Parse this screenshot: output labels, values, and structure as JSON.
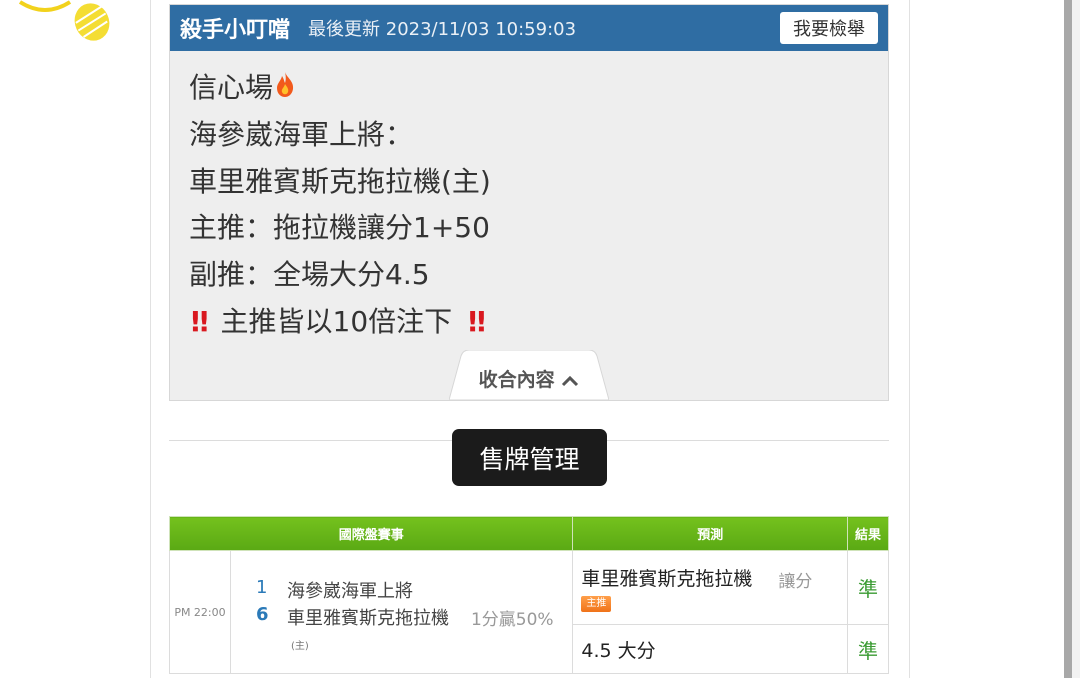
{
  "post": {
    "author": "殺手小叮噹",
    "updated": "最後更新 2023/11/03 10:59:03",
    "report_button": "我要檢舉",
    "lines": [
      "信心場",
      "海參崴海軍上將：",
      "車里雅賓斯克拖拉機(主)",
      "主推：拖拉機讓分1+50",
      "副推：全場大分4.5",
      "主推皆以10倍注下"
    ],
    "collapse_label": "收合內容",
    "icons": {
      "flame": "fire-icon",
      "bang": "double-exclamation-icon",
      "chevron": "chevron-up-icon"
    }
  },
  "tooltip": "售牌管理",
  "table": {
    "headers": [
      "國際盤賽事",
      "預測",
      "結果"
    ],
    "row": {
      "time": "PM 22:00",
      "team1_num": "1",
      "team1": "海參崴海軍上將",
      "team2_num": "6",
      "team2": "車里雅賓斯克拖拉機",
      "line_info": "1分贏50%",
      "home_tag": "(主)",
      "pred1_team": "車里雅賓斯克拖拉機",
      "pred1_type": "讓分",
      "pred1_badge": "主推",
      "result1": "準",
      "pred2": "4.5 大分",
      "result2": "準"
    }
  },
  "colors": {
    "header_blue": "#2f6da3",
    "table_green": "#5aa914",
    "result_green": "#3a9b32",
    "bang_red": "#d9181f"
  }
}
